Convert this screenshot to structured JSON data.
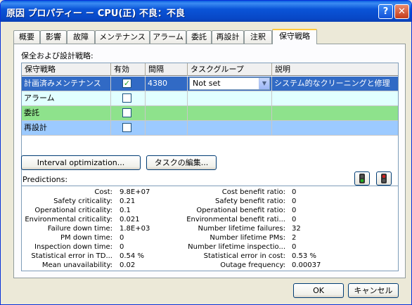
{
  "window": {
    "title": "原因 プロパティー － CPU(正) 不良：不良",
    "help_glyph": "?",
    "close_glyph": "✕"
  },
  "tabs": [
    "概要",
    "影響",
    "故障",
    "メンテナンス",
    "アラーム",
    "委託",
    "再設計",
    "注釈",
    "保守戦略"
  ],
  "group_label": "保全および設計戦略:",
  "grid": {
    "headers": [
      "保守戦略",
      "有効",
      "間隔",
      "タスクグループ",
      "説明"
    ],
    "rows": [
      {
        "strategy": "計画済みメンテナンス",
        "enabled": "✓",
        "interval": "4380",
        "task_group": "Not set",
        "description": "システム的なクリーニングと修理",
        "color": "#316ac5"
      },
      {
        "strategy": "アラーム",
        "enabled": "",
        "interval": "",
        "task_group": "",
        "description": "",
        "color": "#e1ffff"
      },
      {
        "strategy": "委託",
        "enabled": "",
        "interval": "",
        "task_group": "",
        "description": "",
        "color": "#8ee28c"
      },
      {
        "strategy": "再設計",
        "enabled": "",
        "interval": "",
        "task_group": "",
        "description": "",
        "color": "#9ccaff"
      }
    ]
  },
  "buttons": {
    "interval_optimization": "Interval optimization...",
    "edit_tasks": "タスクの編集...",
    "ok": "OK",
    "cancel": "キャンセル"
  },
  "predictions": {
    "label": "Predictions:",
    "left": [
      {
        "label": "Cost:",
        "value": "9.8E+07"
      },
      {
        "label": "Safety criticality:",
        "value": "0.21"
      },
      {
        "label": "Operational criticality:",
        "value": "0.1"
      },
      {
        "label": "Environmental criticality:",
        "value": "0.021"
      },
      {
        "label": "Failure down time:",
        "value": "1.8E+03"
      },
      {
        "label": "PM down time:",
        "value": "0"
      },
      {
        "label": "Inspection down time:",
        "value": "0"
      },
      {
        "label": "Statistical error in TD...",
        "value": "0.54 %"
      },
      {
        "label": "Mean unavailability:",
        "value": "0.02"
      }
    ],
    "right": [
      {
        "label": "Cost benefit ratio:",
        "value": "0"
      },
      {
        "label": "Safety benefit ratio:",
        "value": "0"
      },
      {
        "label": "Operational benefit ratio:",
        "value": "0"
      },
      {
        "label": "Environmental benefit rati...",
        "value": "0"
      },
      {
        "label": "Number lifetime failures:",
        "value": "32"
      },
      {
        "label": "Number lifetime PMs:",
        "value": "2"
      },
      {
        "label": "Number lifetime inspectio...",
        "value": "0"
      },
      {
        "label": "Statistical error in cost:",
        "value": "0.53 %"
      },
      {
        "label": "Outage frequency:",
        "value": "0.00037"
      }
    ]
  },
  "colors": {
    "selected_row": "#316ac5",
    "traffic_green": "#21b021",
    "traffic_red": "#d11f1f"
  }
}
